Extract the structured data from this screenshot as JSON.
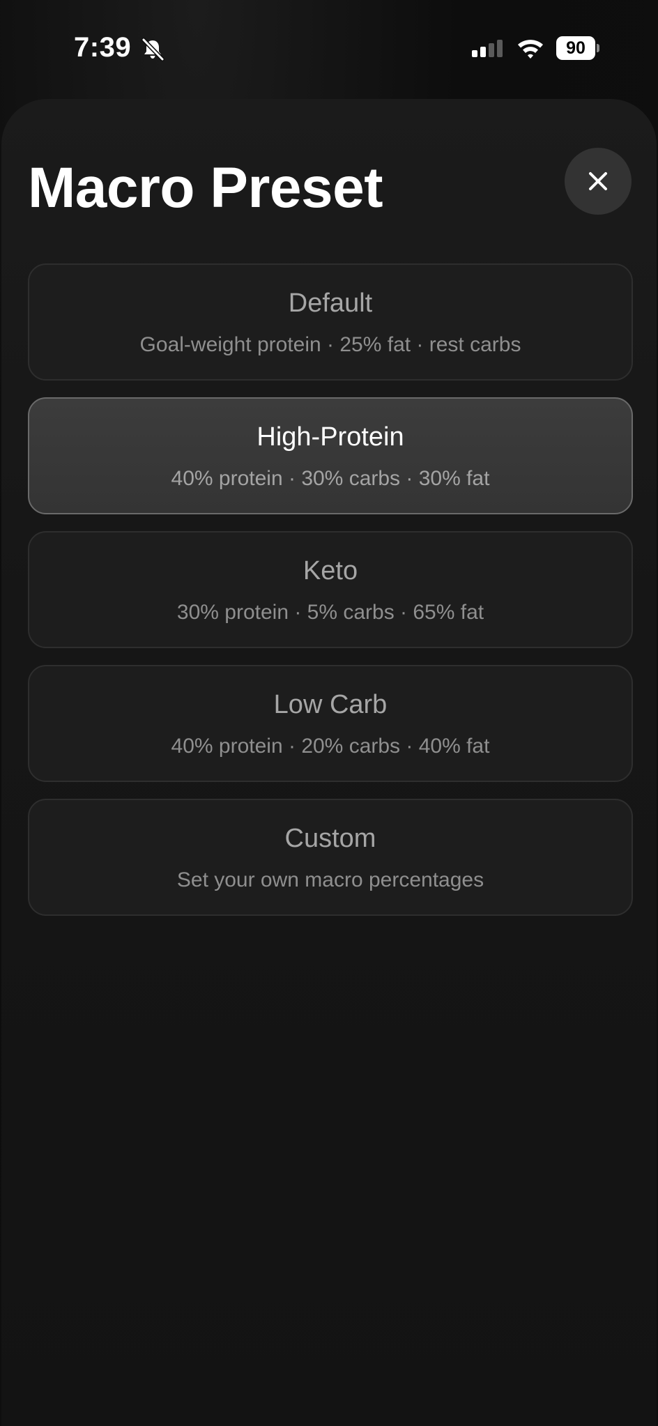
{
  "status_bar": {
    "time": "7:39",
    "battery": "90",
    "icons": [
      "bell-slash-icon",
      "cellular-signal-icon",
      "wifi-icon",
      "battery-icon"
    ]
  },
  "sheet": {
    "title": "Macro Preset",
    "close_icon": "close-icon"
  },
  "presets": [
    {
      "title": "Default",
      "description": "Goal-weight protein · 25% fat · rest carbs",
      "selected": false
    },
    {
      "title": "High-Protein",
      "description": "40% protein · 30% carbs · 30% fat",
      "selected": true
    },
    {
      "title": "Keto",
      "description": "30% protein · 5% carbs · 65% fat",
      "selected": false
    },
    {
      "title": "Low Carb",
      "description": "40% protein · 20% carbs · 40% fat",
      "selected": false
    },
    {
      "title": "Custom",
      "description": "Set your own macro percentages",
      "selected": false
    }
  ],
  "colors": {
    "background": "#0e0e0e",
    "sheet": "#181818",
    "option_background": "#1d1d1d",
    "option_selected_background": "#383838",
    "option_border": "#2e2e2e",
    "option_selected_border": "#6a6a6a",
    "text_primary": "#ffffff",
    "text_muted": "#a6a6a6"
  }
}
